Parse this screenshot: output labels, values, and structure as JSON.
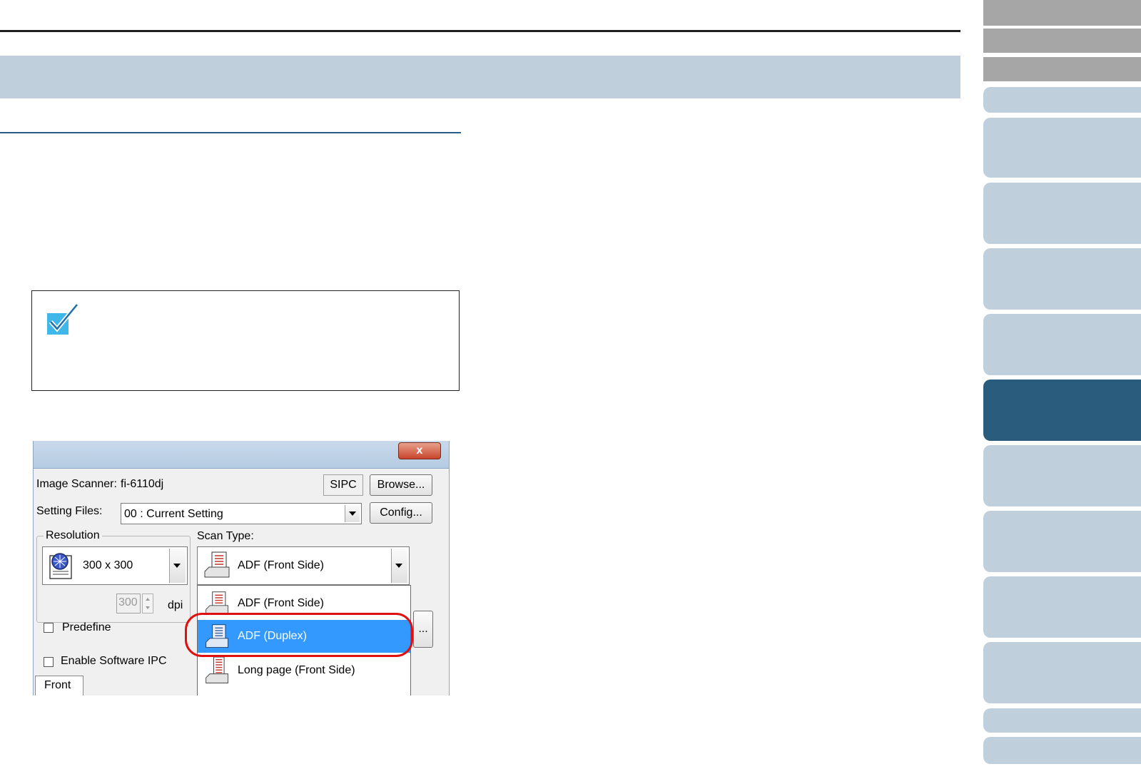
{
  "dialog": {
    "close_label": "x",
    "image_scanner_label": "Image Scanner:",
    "image_scanner_value": "fi-6110dj",
    "sipc_label": "SIPC",
    "browse_label": "Browse...",
    "setting_files_label": "Setting Files:",
    "setting_files_value": "00 : Current Setting",
    "config_label": "Config...",
    "resolution_group": "Resolution",
    "resolution_value": "300 x 300",
    "dpi_value": "300",
    "dpi_unit": "dpi",
    "predefine_label": "Predefine",
    "scan_type_label": "Scan Type:",
    "scan_type_value": "ADF (Front Side)",
    "more_label": "...",
    "enable_ipc_label": "Enable Software IPC",
    "front_tab": "Front",
    "scan_type_options": [
      {
        "label": "ADF (Front Side)",
        "selected": false
      },
      {
        "label": "ADF (Duplex)",
        "selected": true
      },
      {
        "label": "Long page (Front Side)",
        "selected": false
      }
    ]
  },
  "colors": {
    "banner": "#bfd0dc",
    "sidebar_active": "#2a5d7d",
    "selection": "#3399ff",
    "highlight": "#e01010"
  }
}
